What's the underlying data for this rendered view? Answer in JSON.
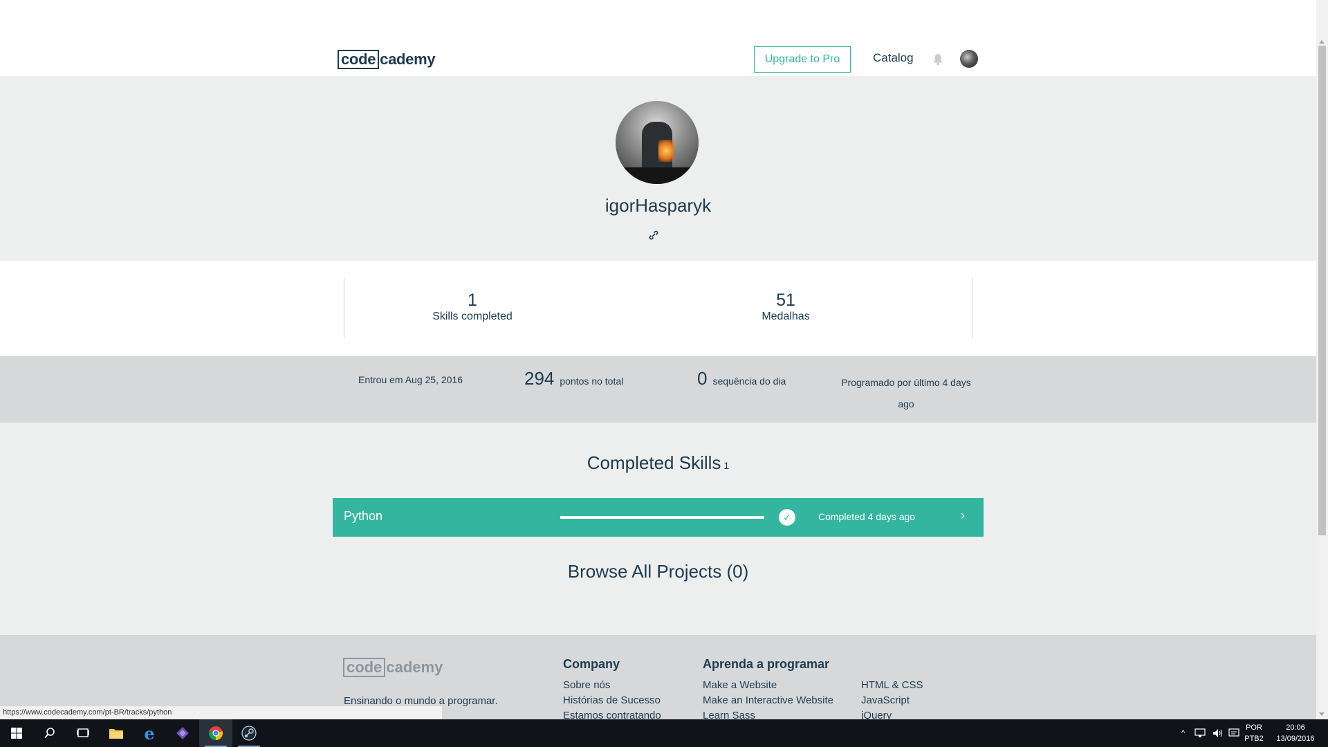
{
  "header": {
    "logo_left": "code",
    "logo_right": "cademy",
    "upgrade_label": "Upgrade to Pro",
    "catalog_label": "Catalog"
  },
  "profile": {
    "username": "igorHasparyk"
  },
  "stats": {
    "skills_value": "1",
    "skills_label": "Skills completed",
    "badges_value": "51",
    "badges_label": "Medalhas"
  },
  "info": {
    "joined": "Entrou em Aug 25, 2016",
    "points_value": "294",
    "points_label": "pontos no total",
    "streak_value": "0",
    "streak_label": "sequência do dia",
    "last_coded_line1": "Programado por último 4 days",
    "last_coded_line2": "ago"
  },
  "skills": {
    "title": "Completed Skills",
    "count": "1",
    "items": [
      {
        "name": "Python",
        "progress": 1.0,
        "status": "Completed 4 days ago"
      }
    ]
  },
  "projects": {
    "title": "Browse All Projects (0)"
  },
  "footer": {
    "logo_left": "code",
    "logo_right": "cademy",
    "tagline": "Ensinando o mundo a programar.",
    "company_heading": "Company",
    "company_links": [
      "Sobre nós",
      "Histórias de Sucesso",
      "Estamos contratando"
    ],
    "learn_heading": "Aprenda a programar",
    "learn_links_col1": [
      "Make a Website",
      "Make an Interactive Website",
      "Learn Sass"
    ],
    "learn_links_col2": [
      "HTML & CSS",
      "JavaScript",
      "jQuery"
    ]
  },
  "status_bar": {
    "url": "https://www.codecademy.com/pt-BR/tracks/python"
  },
  "taskbar": {
    "lang_line1": "POR",
    "lang_line2": "PTB2",
    "time": "20:06",
    "date": "13/09/2016"
  },
  "colors": {
    "accent": "#34b5a0",
    "text": "#1d3b50",
    "band": "#d7d8d9",
    "hero": "#edeeee"
  }
}
